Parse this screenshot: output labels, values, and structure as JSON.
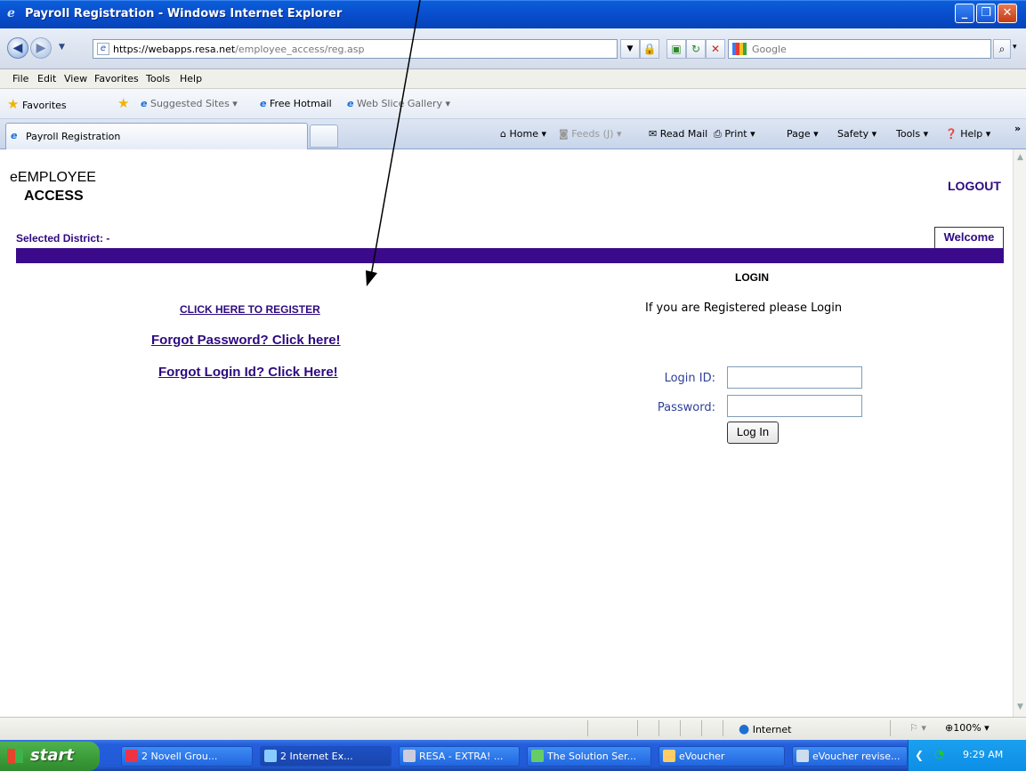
{
  "window": {
    "title": "Payroll Registration - Windows Internet Explorer"
  },
  "address": {
    "scheme": "https://",
    "host": "webapps.resa.net",
    "path": "/employee_access/reg.asp"
  },
  "search": {
    "placeholder": "Google"
  },
  "menu": [
    "File",
    "Edit",
    "View",
    "Favorites",
    "Tools",
    "Help"
  ],
  "favorites": {
    "label": "Favorites",
    "items": [
      "Suggested Sites ▾",
      "Free Hotmail",
      "Web Slice Gallery ▾"
    ]
  },
  "tab": {
    "title": "Payroll Registration"
  },
  "commandbar": {
    "home": "Home",
    "feeds": "Feeds (J)",
    "readmail": "Read Mail",
    "print": "Print",
    "page": "Page",
    "safety": "Safety",
    "tools": "Tools",
    "help": "Help",
    "more": "»"
  },
  "page": {
    "brand_line1": "eEMPLOYEE",
    "brand_line2": "ACCESS",
    "logout": "LOGOUT",
    "selected_district": "Selected District:  -",
    "welcome_tab": "Welcome",
    "register_link": "CLICK HERE TO REGISTER",
    "forgot_password": "Forgot Password? Click here!",
    "forgot_login": "Forgot Login Id? Click Here!",
    "login_heading": "LOGIN",
    "login_message": "If you are Registered please Login",
    "login_id_label": "Login ID:",
    "password_label": "Password:",
    "login_button": "Log In"
  },
  "statusbar": {
    "zone": "Internet",
    "zoom": "100%"
  },
  "taskbar": {
    "start": "start",
    "tasks": [
      "2 Novell Grou...",
      "2 Internet Ex...",
      "RESA - EXTRA! ...",
      "The Solution Ser...",
      "eVoucher",
      "eVoucher revise..."
    ],
    "clock": "9:29 AM"
  },
  "colors": {
    "accent_purple": "#3b0a8a",
    "link_purple": "#2d0a80",
    "title_blue": "#0950d0"
  }
}
